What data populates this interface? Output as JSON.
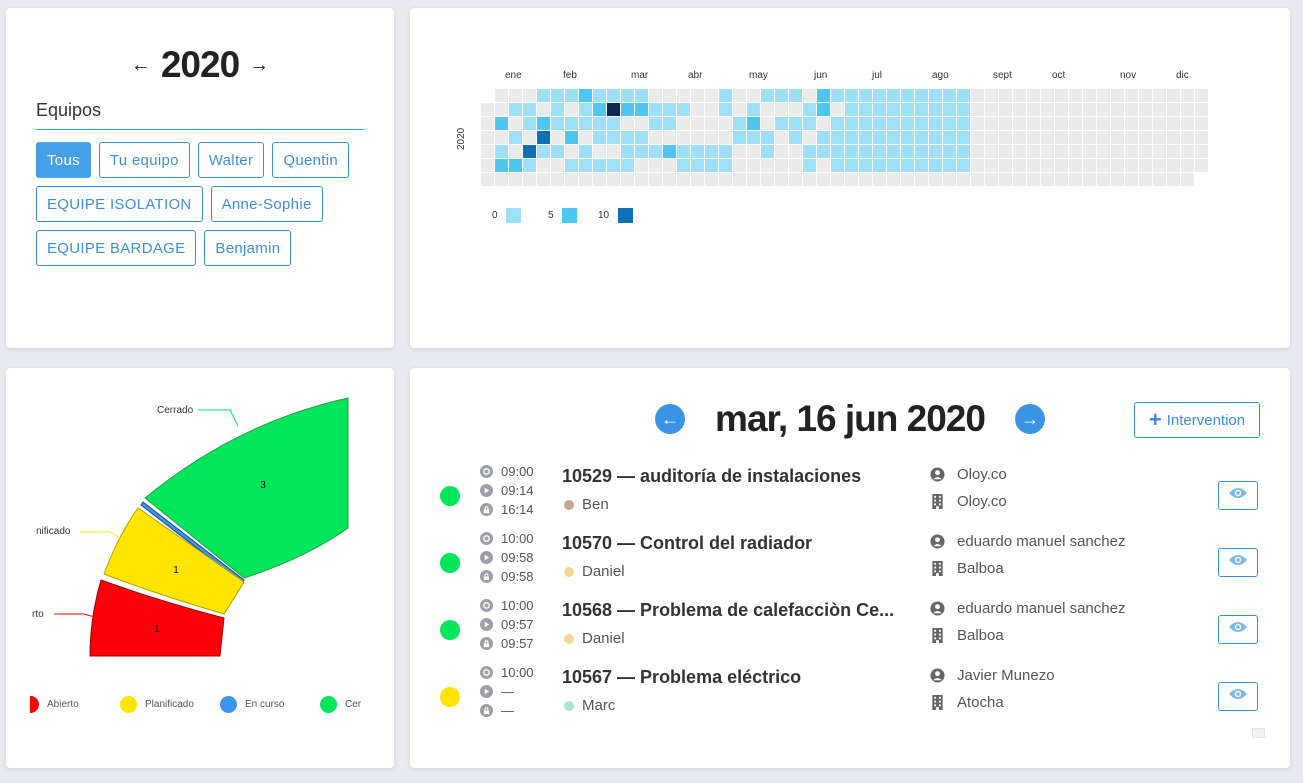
{
  "year_panel": {
    "prev_arrow": "←",
    "year": "2020",
    "next_arrow": "→",
    "teams_title": "Equipos",
    "teams": [
      {
        "label": "Tous",
        "active": true
      },
      {
        "label": "Tu equipo",
        "active": false
      },
      {
        "label": "Walter",
        "active": false
      },
      {
        "label": "Quentin",
        "active": false
      },
      {
        "label": "EQUIPE ISOLATION",
        "active": false
      },
      {
        "label": "Anne-Sophie",
        "active": false
      },
      {
        "label": "EQUIPE BARDAGE",
        "active": false
      },
      {
        "label": "Benjamin",
        "active": false
      }
    ]
  },
  "heatmap": {
    "year_label": "2020",
    "months": [
      "ene",
      "feb",
      "mar",
      "abr",
      "may",
      "jun",
      "jul",
      "ago",
      "sept",
      "oct",
      "nov",
      "dic"
    ],
    "legend": [
      {
        "value": "0",
        "color": "#9ee0f8"
      },
      {
        "value": "5",
        "color": "#4fc6ef"
      },
      {
        "value": "10",
        "color": "#0d6fb8"
      }
    ],
    "colors": {
      "empty": "#ebebeb",
      "l1": "#9ee0f8",
      "l2": "#4fc6ef",
      "l3": "#0d6fb8",
      "l4": "#0b2a55"
    },
    "highlighted_days": [
      [
        1,
        2,
        2
      ],
      [
        1,
        4,
        1
      ],
      [
        1,
        5,
        2
      ],
      [
        2,
        1,
        1
      ],
      [
        2,
        3,
        1
      ],
      [
        2,
        5,
        2
      ],
      [
        3,
        1,
        1
      ],
      [
        3,
        2,
        1
      ],
      [
        3,
        4,
        3
      ],
      [
        3,
        5,
        1
      ],
      [
        4,
        0,
        1
      ],
      [
        4,
        2,
        2
      ],
      [
        4,
        3,
        3
      ],
      [
        4,
        4,
        1
      ],
      [
        5,
        0,
        1
      ],
      [
        5,
        1,
        1
      ],
      [
        5,
        2,
        1
      ],
      [
        5,
        4,
        1
      ],
      [
        6,
        0,
        1
      ],
      [
        6,
        2,
        1
      ],
      [
        6,
        3,
        2
      ],
      [
        6,
        5,
        1
      ],
      [
        7,
        0,
        2
      ],
      [
        7,
        1,
        1
      ],
      [
        7,
        2,
        1
      ],
      [
        7,
        4,
        1
      ],
      [
        7,
        5,
        1
      ],
      [
        8,
        0,
        1
      ],
      [
        8,
        1,
        2
      ],
      [
        8,
        2,
        1
      ],
      [
        8,
        3,
        1
      ],
      [
        8,
        5,
        1
      ],
      [
        9,
        0,
        1
      ],
      [
        9,
        1,
        4
      ],
      [
        9,
        2,
        1
      ],
      [
        9,
        3,
        1
      ],
      [
        9,
        5,
        1
      ],
      [
        10,
        0,
        1
      ],
      [
        10,
        1,
        2
      ],
      [
        10,
        3,
        1
      ],
      [
        10,
        4,
        1
      ],
      [
        10,
        5,
        1
      ],
      [
        11,
        0,
        1
      ],
      [
        11,
        1,
        2
      ],
      [
        11,
        3,
        1
      ],
      [
        11,
        4,
        1
      ],
      [
        12,
        1,
        1
      ],
      [
        12,
        2,
        1
      ],
      [
        12,
        4,
        1
      ],
      [
        13,
        1,
        1
      ],
      [
        13,
        2,
        1
      ],
      [
        13,
        4,
        2
      ],
      [
        14,
        1,
        1
      ],
      [
        14,
        4,
        1
      ],
      [
        14,
        5,
        1
      ],
      [
        15,
        4,
        1
      ],
      [
        15,
        5,
        1
      ],
      [
        16,
        4,
        1
      ],
      [
        16,
        5,
        1
      ],
      [
        17,
        0,
        1
      ],
      [
        17,
        1,
        1
      ],
      [
        17,
        4,
        1
      ],
      [
        17,
        5,
        1
      ],
      [
        18,
        2,
        1
      ],
      [
        18,
        3,
        1
      ],
      [
        19,
        1,
        1
      ],
      [
        19,
        2,
        2
      ],
      [
        19,
        3,
        1
      ],
      [
        20,
        0,
        1
      ],
      [
        20,
        3,
        1
      ],
      [
        20,
        4,
        1
      ],
      [
        21,
        0,
        1
      ],
      [
        21,
        2,
        1
      ],
      [
        22,
        0,
        1
      ],
      [
        22,
        2,
        1
      ],
      [
        22,
        3,
        1
      ],
      [
        23,
        1,
        1
      ],
      [
        23,
        2,
        1
      ],
      [
        23,
        4,
        1
      ],
      [
        23,
        5,
        1
      ],
      [
        24,
        0,
        2
      ],
      [
        24,
        1,
        2
      ],
      [
        24,
        3,
        1
      ],
      [
        24,
        4,
        1
      ],
      [
        25,
        0,
        1
      ],
      [
        25,
        2,
        1
      ],
      [
        25,
        3,
        1
      ],
      [
        25,
        4,
        1
      ],
      [
        25,
        5,
        1
      ],
      [
        26,
        0,
        1
      ],
      [
        26,
        1,
        1
      ],
      [
        26,
        2,
        1
      ],
      [
        26,
        3,
        1
      ],
      [
        26,
        4,
        1
      ],
      [
        26,
        5,
        1
      ],
      [
        27,
        0,
        1
      ],
      [
        27,
        1,
        1
      ],
      [
        27,
        2,
        1
      ],
      [
        27,
        3,
        1
      ],
      [
        27,
        4,
        1
      ],
      [
        27,
        5,
        1
      ],
      [
        28,
        0,
        1
      ],
      [
        28,
        1,
        1
      ],
      [
        28,
        2,
        1
      ],
      [
        28,
        3,
        1
      ],
      [
        28,
        4,
        1
      ],
      [
        28,
        5,
        1
      ],
      [
        29,
        0,
        1
      ],
      [
        29,
        1,
        1
      ],
      [
        29,
        2,
        1
      ],
      [
        29,
        3,
        1
      ],
      [
        29,
        4,
        1
      ],
      [
        29,
        5,
        1
      ],
      [
        30,
        0,
        1
      ],
      [
        30,
        1,
        1
      ],
      [
        30,
        2,
        1
      ],
      [
        30,
        3,
        1
      ],
      [
        30,
        4,
        1
      ],
      [
        30,
        5,
        1
      ],
      [
        31,
        0,
        1
      ],
      [
        31,
        1,
        1
      ],
      [
        31,
        2,
        1
      ],
      [
        31,
        3,
        1
      ],
      [
        31,
        4,
        1
      ],
      [
        31,
        5,
        1
      ],
      [
        32,
        0,
        1
      ],
      [
        32,
        1,
        1
      ],
      [
        32,
        2,
        1
      ],
      [
        32,
        3,
        1
      ],
      [
        32,
        4,
        1
      ],
      [
        32,
        5,
        1
      ],
      [
        33,
        0,
        1
      ],
      [
        33,
        1,
        1
      ],
      [
        33,
        2,
        1
      ],
      [
        33,
        3,
        1
      ],
      [
        33,
        4,
        1
      ],
      [
        33,
        5,
        1
      ],
      [
        34,
        0,
        1
      ],
      [
        34,
        1,
        1
      ],
      [
        34,
        2,
        1
      ],
      [
        34,
        3,
        1
      ],
      [
        34,
        4,
        1
      ],
      [
        34,
        5,
        1
      ]
    ]
  },
  "status_pie": {
    "labels": [
      {
        "text": "Cerrado"
      },
      {
        "text": "nificado"
      },
      {
        "text": "rto"
      }
    ],
    "segments": [
      {
        "name": "Abierto",
        "value": "1",
        "color": "#fb0007"
      },
      {
        "name": "Planificado",
        "value": "1",
        "color": "#ffe500"
      },
      {
        "name": "En curso",
        "value": "",
        "color": "#3d95eb"
      },
      {
        "name": "Cerrado",
        "value": "3",
        "color": "#00e65a"
      }
    ],
    "legend": [
      {
        "text": "Abierto",
        "color": "#fb0007"
      },
      {
        "text": "Planificado",
        "color": "#ffe500"
      },
      {
        "text": "En curso",
        "color": "#3d95eb"
      },
      {
        "text": "Cer",
        "color": "#00e65a"
      }
    ]
  },
  "day_panel": {
    "prev_arrow": "←",
    "date_title": "mar, 16 jun 2020",
    "next_arrow": "→",
    "add_label": "Intervention",
    "rows": [
      {
        "status_color": "#00e65a",
        "t1": "09:00",
        "t2": "09:14",
        "t3": "16:14",
        "title": "10529 — auditoría de instalaciones",
        "tech": "Ben",
        "tech_color": "#c9a38c",
        "client": "Oloy.co",
        "site": "Oloy.co"
      },
      {
        "status_color": "#00e65a",
        "t1": "10:00",
        "t2": "09:58",
        "t3": "09:58",
        "title": "10570 — Control del radiador",
        "tech": "Daniel",
        "tech_color": "#f3d595",
        "client": "eduardo manuel sanchez",
        "site": "Balboa"
      },
      {
        "status_color": "#00e65a",
        "t1": "10:00",
        "t2": "09:57",
        "t3": "09:57",
        "title": "10568 — Problema de calefacciòn Ce...",
        "tech": "Daniel",
        "tech_color": "#f3d595",
        "client": "eduardo manuel sanchez",
        "site": "Balboa"
      },
      {
        "status_color": "#ffe500",
        "t1": "10:00",
        "t2": "—",
        "t3": "—",
        "title": "10567 — Problema eléctrico",
        "tech": "Marc",
        "tech_color": "#a8e6d3",
        "client": "Javier Munezo",
        "site": "Atocha"
      }
    ]
  }
}
